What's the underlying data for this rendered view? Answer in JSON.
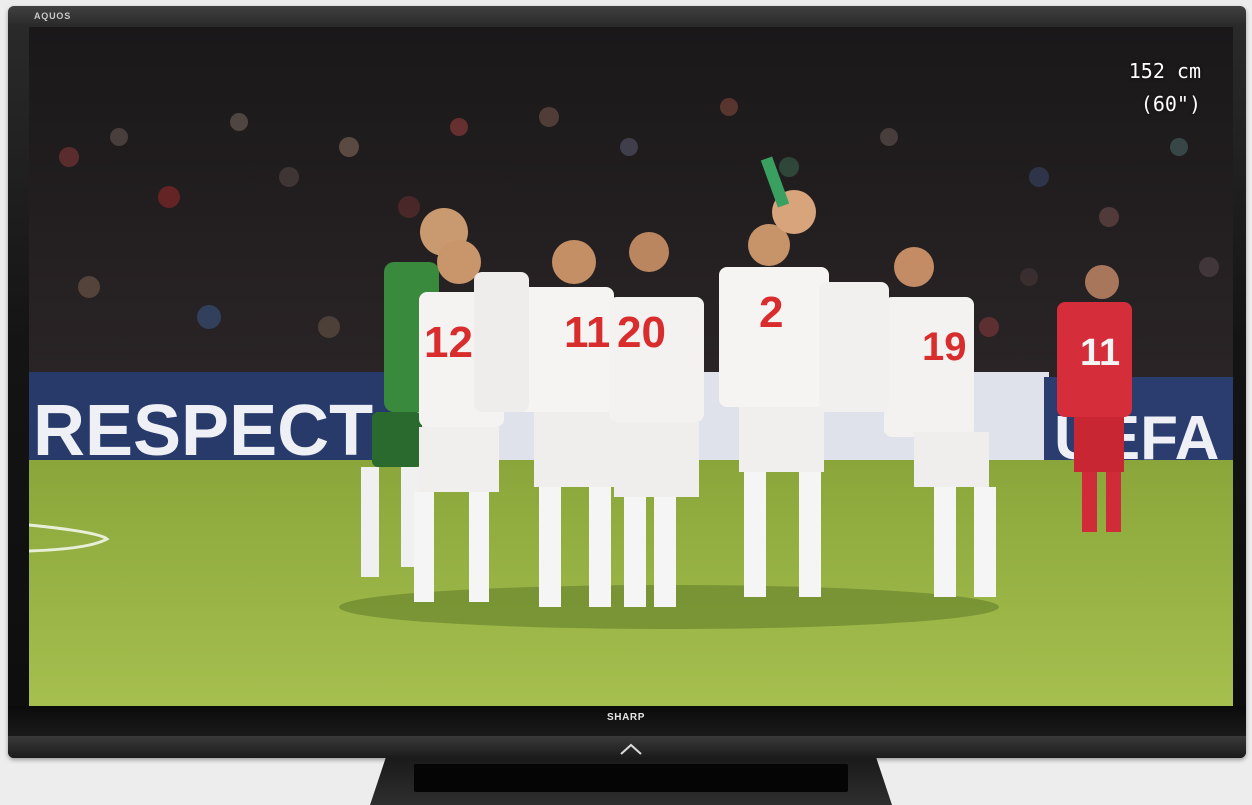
{
  "tv": {
    "brand_top": "AQUOS",
    "brand_bottom": "SHARP",
    "size_cm": "152 cm",
    "size_inch": "(60\")"
  },
  "scene": {
    "banner_left": "RESPECT",
    "banner_right": "UEFA",
    "jerseys": [
      "12",
      "11",
      "20",
      "2",
      "19",
      "11"
    ]
  },
  "icons": {
    "power_indicator": "chevron-up-icon"
  }
}
